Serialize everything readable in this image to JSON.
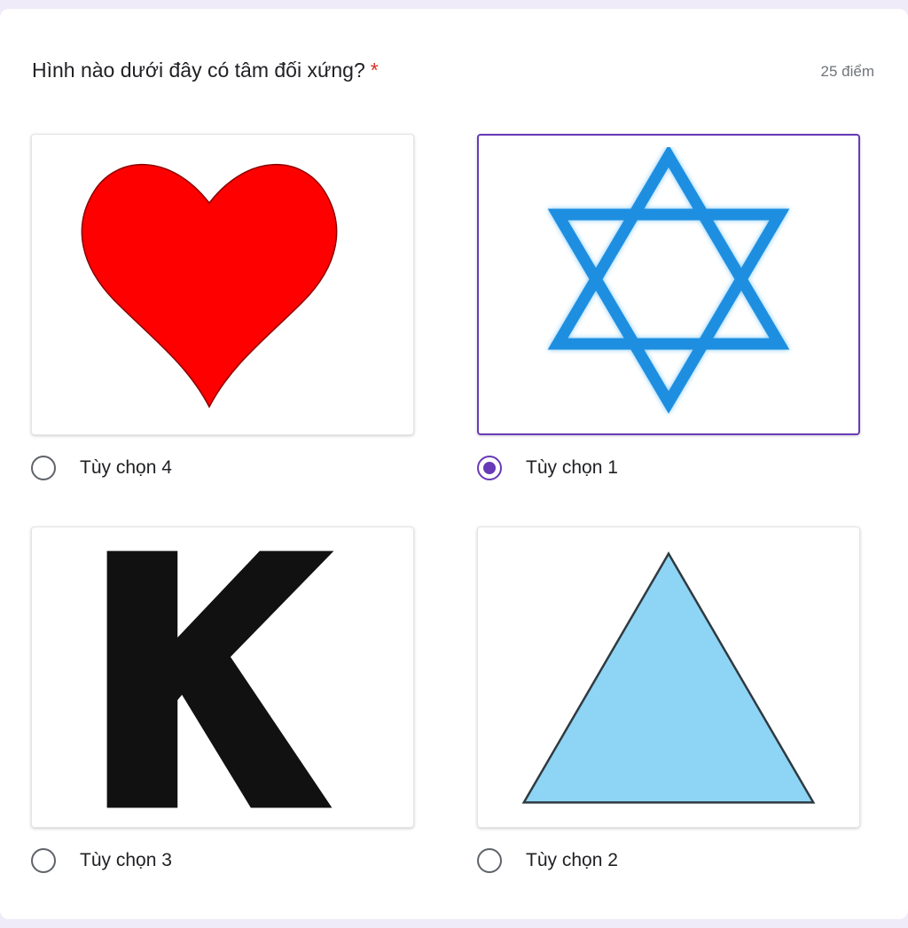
{
  "question": {
    "title": "Hình nào dưới đây có tâm đối xứng?",
    "required_mark": "*",
    "points": "25 điểm"
  },
  "options": [
    {
      "label": "Tùy chọn 4",
      "image": "red-heart",
      "selected": false
    },
    {
      "label": "Tùy chọn 1",
      "image": "blue-six-pointed-star",
      "selected": true
    },
    {
      "label": "Tùy chọn 3",
      "image": "black-letter-k",
      "selected": false
    },
    {
      "label": "Tùy chọn 2",
      "image": "light-blue-triangle",
      "selected": false
    }
  ],
  "colors": {
    "accent": "#673ab7",
    "heart": "#ff0000",
    "star": "#1e8fe0",
    "letter": "#111111",
    "triangle": "#8ed4f5"
  }
}
